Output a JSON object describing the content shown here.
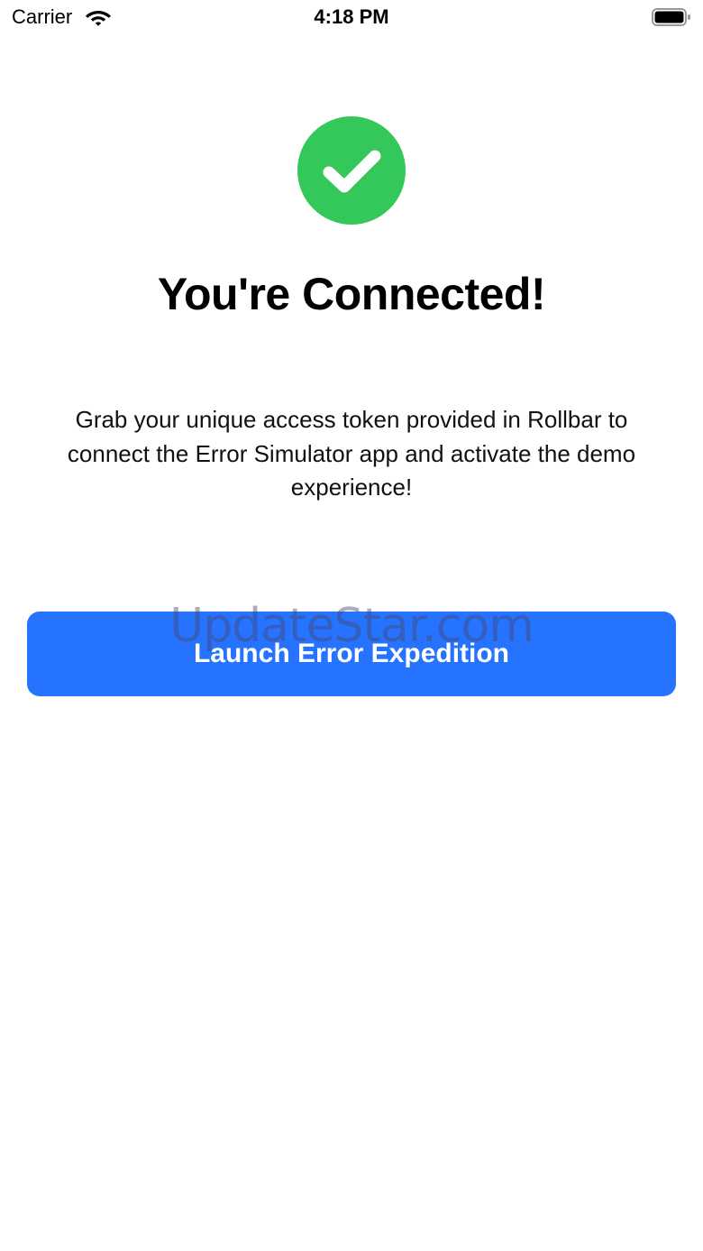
{
  "status_bar": {
    "carrier": "Carrier",
    "time": "4:18 PM",
    "wifi_icon": "wifi-icon",
    "battery_icon": "battery-icon"
  },
  "main": {
    "badge_icon": "checkmark-circle-icon",
    "badge_color": "#34c759",
    "title": "You're Connected!",
    "description": "Grab your unique access token provided in Rollbar to connect the Error Simulator app and activate the demo experience!",
    "launch_button_label": "Launch Error Expedition",
    "accent_color": "#2673ff"
  },
  "watermark": {
    "text": "UpdateStar.com"
  }
}
